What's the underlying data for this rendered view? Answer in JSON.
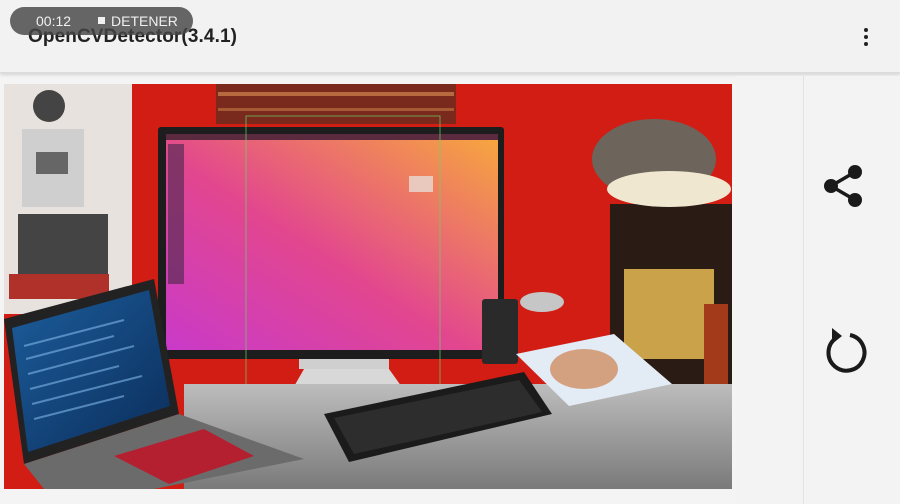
{
  "app": {
    "title": "OpenCVDetector(3.4.1)"
  },
  "recording": {
    "time": "00:12",
    "stop_label": "DETENER"
  },
  "menu": {
    "icon": "overflow-menu-icon"
  },
  "actions": {
    "share_icon": "share-icon",
    "retry_icon": "rotate-icon"
  },
  "colors": {
    "wall": "#d71f16",
    "screen_pink": "#d93fc8",
    "screen_orange": "#f7a03c"
  }
}
